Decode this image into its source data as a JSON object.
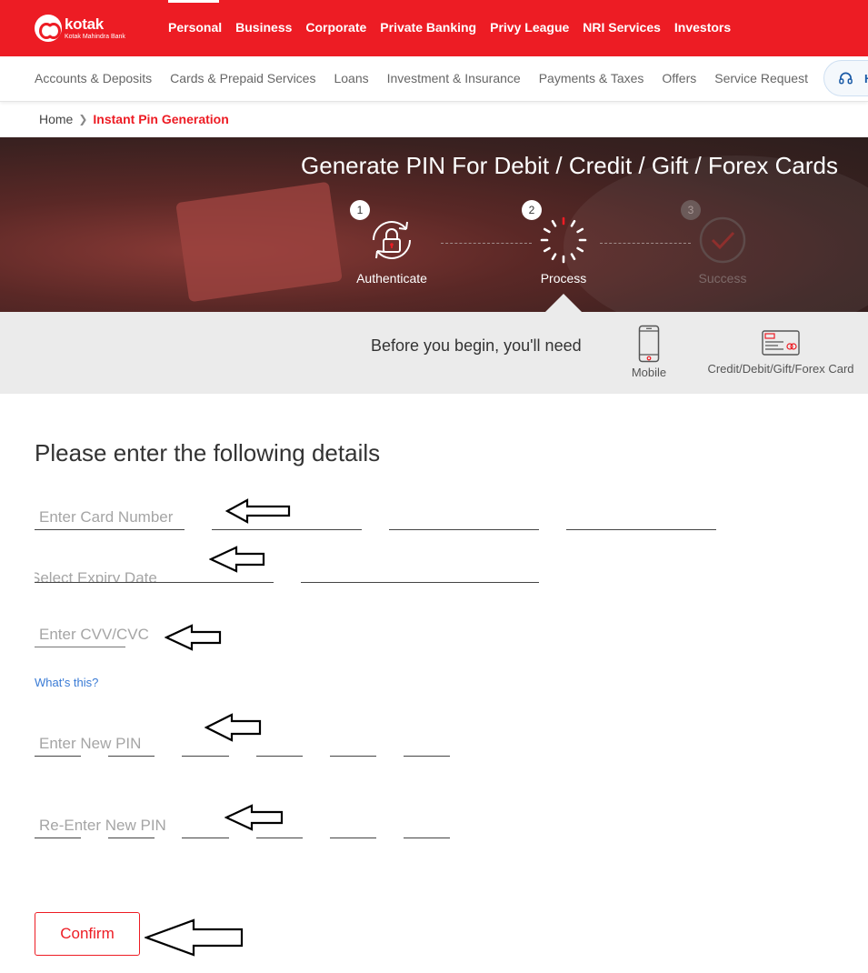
{
  "brand": {
    "name": "kotak",
    "tagline": "Kotak Mahindra Bank"
  },
  "top_nav": [
    "Personal",
    "Business",
    "Corporate",
    "Private Banking",
    "Privy League",
    "NRI Services",
    "Investors"
  ],
  "sub_nav": [
    "Accounts & Deposits",
    "Cards & Prepaid Services",
    "Loans",
    "Investment & Insurance",
    "Payments & Taxes",
    "Offers",
    "Service Request"
  ],
  "help_label": "H",
  "breadcrumb": {
    "home": "Home",
    "current": "Instant Pin Generation"
  },
  "hero": {
    "title": "Generate PIN For Debit / Credit / Gift / Forex Cards",
    "steps": [
      {
        "num": "1",
        "label": "Authenticate"
      },
      {
        "num": "2",
        "label": "Process"
      },
      {
        "num": "3",
        "label": "Success"
      }
    ]
  },
  "requirements": {
    "text": "Before you begin, you'll need",
    "items": [
      "Mobile",
      "Credit/Debit/Gift/Forex Card"
    ]
  },
  "form": {
    "title": "Please enter the following details",
    "card_number_placeholder": "Enter Card Number",
    "expiry_placeholder": "Select Expiry Date",
    "cvv_placeholder": "Enter CVV/CVC",
    "whats_this": "What's this?",
    "new_pin_placeholder": "Enter New PIN",
    "reenter_pin_placeholder": "Re-Enter New PIN",
    "confirm_label": "Confirm"
  },
  "colors": {
    "brand_red": "#ed1c24",
    "link_blue": "#3a7bd5"
  }
}
